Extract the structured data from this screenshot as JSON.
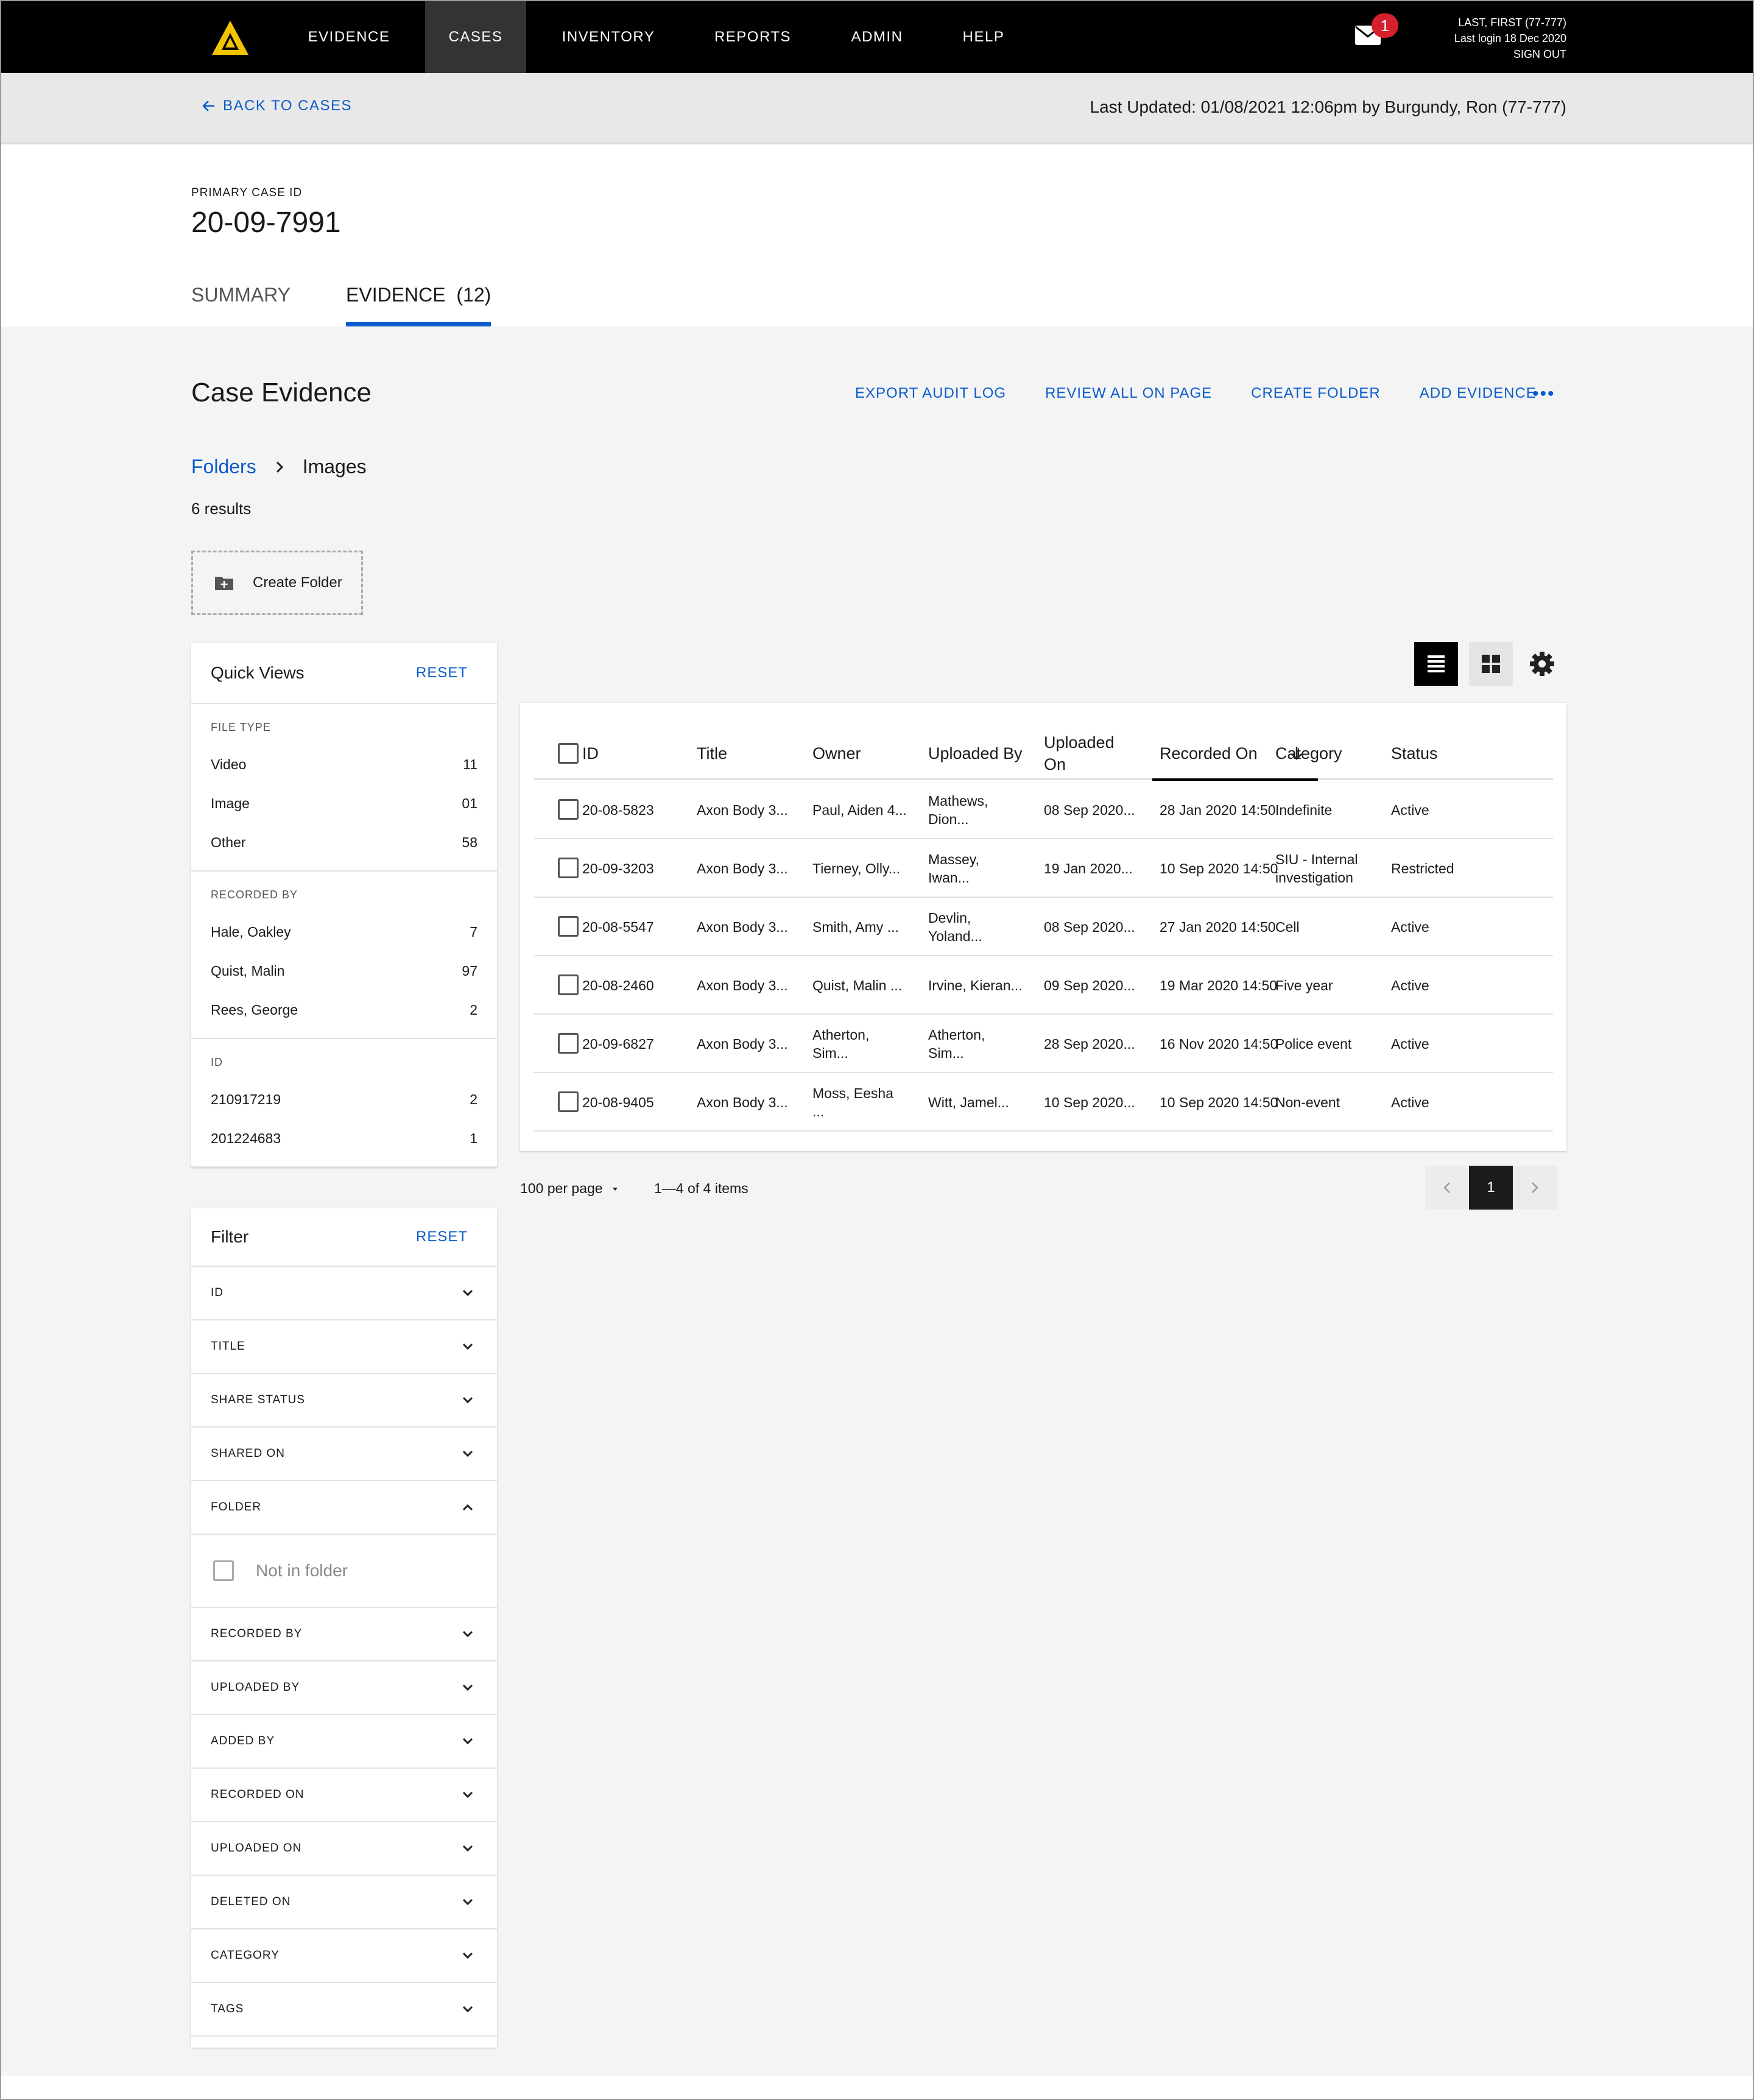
{
  "nav": {
    "items": [
      {
        "label": "EVIDENCE",
        "active": false
      },
      {
        "label": "CASES",
        "active": true
      },
      {
        "label": "INVENTORY",
        "active": false
      },
      {
        "label": "REPORTS",
        "active": false
      },
      {
        "label": "ADMIN",
        "active": false
      },
      {
        "label": "HELP",
        "active": false
      }
    ],
    "mail_badge": "1",
    "user_name": "LAST, FIRST (77-777)",
    "last_login": "Last login 18 Dec 2020",
    "sign_out": "SIGN OUT"
  },
  "backbar": {
    "back_label": "BACK TO CASES",
    "last_updated": "Last Updated: 01/08/2021  12:06pm by Burgundy, Ron (77-777)"
  },
  "header": {
    "case_id_label": "PRIMARY CASE ID",
    "case_id": "20-09-7991",
    "tabs": [
      {
        "label": "SUMMARY",
        "active": false
      },
      {
        "label": "EVIDENCE  (12)",
        "active": true
      }
    ]
  },
  "main": {
    "title": "Case Evidence",
    "actions": [
      "EXPORT AUDIT LOG",
      "REVIEW ALL ON PAGE",
      "CREATE FOLDER",
      "ADD EVIDENCE"
    ],
    "more": "•••",
    "breadcrumb": {
      "root": "Folders",
      "current": "Images"
    },
    "results": "6 results",
    "create_folder": "Create Folder"
  },
  "quick_views": {
    "title": "Quick Views",
    "reset": "RESET",
    "sections": [
      {
        "label": "FILE TYPE",
        "rows": [
          {
            "name": "Video",
            "count": "11"
          },
          {
            "name": "Image",
            "count": "01"
          },
          {
            "name": "Other",
            "count": "58"
          }
        ]
      },
      {
        "label": "RECORDED BY",
        "rows": [
          {
            "name": "Hale, Oakley",
            "count": "7"
          },
          {
            "name": "Quist, Malin",
            "count": "97"
          },
          {
            "name": "Rees, George",
            "count": "2"
          }
        ]
      },
      {
        "label": "ID",
        "rows": [
          {
            "name": "210917219",
            "count": "2"
          },
          {
            "name": "201224683",
            "count": "1"
          }
        ]
      }
    ]
  },
  "filter": {
    "title": "Filter",
    "reset": "RESET",
    "rows_before": [
      "ID",
      "TITLE",
      "SHARE STATUS",
      "SHARED ON"
    ],
    "folder_label": "FOLDER",
    "folder_option": "Not in folder",
    "rows_after": [
      "RECORDED BY",
      "UPLOADED BY",
      "ADDED BY",
      "RECORDED ON",
      "UPLOADED ON",
      "DELETED ON",
      "CATEGORY",
      "TAGS"
    ]
  },
  "table": {
    "columns": [
      "ID",
      "Title",
      "Owner",
      "Uploaded By",
      "Uploaded\nOn",
      "Recorded On",
      "Category",
      "Status"
    ],
    "rows": [
      [
        "20-08-5823",
        "Axon Body 3...",
        "Paul, Aiden 4...",
        "Mathews,\nDion...",
        "08 Sep 2020...",
        "28 Jan 2020 14:50",
        "Indefinite",
        "Active"
      ],
      [
        "20-09-3203",
        "Axon Body 3...",
        "Tierney, Olly...",
        "Massey,\nIwan...",
        "19 Jan 2020...",
        "10 Sep 2020 14:50",
        "SIU - Internal\ninvestigation",
        "Restricted"
      ],
      [
        "20-08-5547",
        "Axon Body 3...",
        "Smith, Amy ...",
        "Devlin,\nYoland...",
        "08 Sep 2020...",
        "27 Jan 2020 14:50",
        "Cell",
        "Active"
      ],
      [
        "20-08-2460",
        "Axon Body 3...",
        "Quist, Malin ...",
        "Irvine, Kieran...",
        "09 Sep 2020...",
        "19 Mar 2020 14:50",
        "Five year",
        "Active"
      ],
      [
        "20-09-6827",
        "Axon Body 3...",
        "Atherton,\nSim...",
        "Atherton,\nSim...",
        "28 Sep 2020...",
        "16 Nov 2020 14:50",
        "Police event",
        "Active"
      ],
      [
        "20-08-9405",
        "Axon Body 3...",
        "Moss, Eesha\n...",
        "Witt, Jamel...",
        "10 Sep 2020...",
        "10 Sep 2020 14:50",
        "Non-event",
        "Active"
      ]
    ]
  },
  "pagination": {
    "per_page": "100 per page",
    "range": "1—4 of 4 items",
    "current_page": "1"
  },
  "colors": {
    "accent": "#0a5ccc",
    "badge": "#d6202d",
    "logo": "#f5c400"
  }
}
